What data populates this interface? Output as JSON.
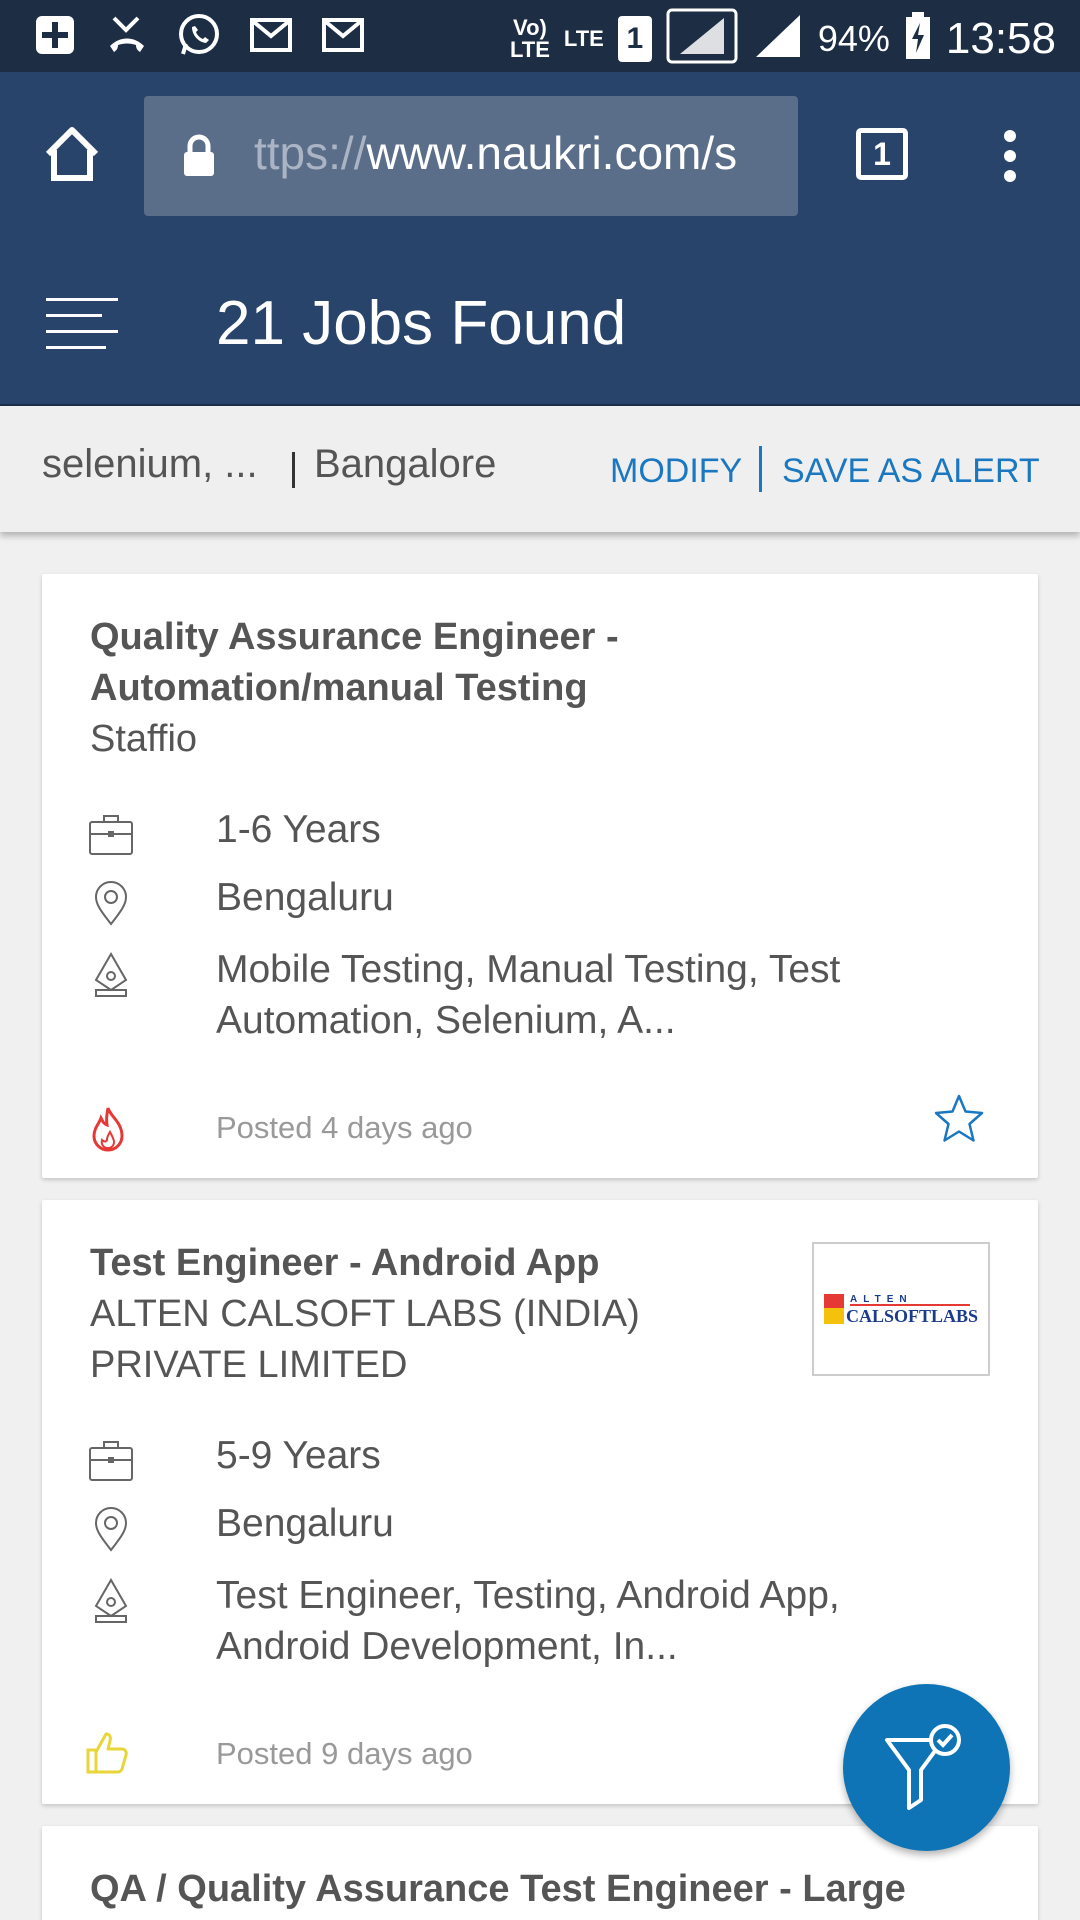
{
  "status_bar": {
    "network": "Vo) LTE",
    "lte": "LTE",
    "sim": "1",
    "battery": "94%",
    "time": "13:58"
  },
  "browser": {
    "url_prefix": "ttps://",
    "url_rest": "www.naukri.com/s",
    "tab_count": "1"
  },
  "header": {
    "title": "21 Jobs Found"
  },
  "search": {
    "keyword": "selenium, ...",
    "location": "Bangalore",
    "modify_label": "MODIFY",
    "alert_label": "SAVE AS ALERT"
  },
  "jobs": [
    {
      "title_line1": "Quality Assurance Engineer -",
      "title_line2": "Automation/manual Testing",
      "company": "Staffio",
      "experience": "1-6 Years",
      "location": "Bengaluru",
      "skills_line1": "Mobile Testing, Manual Testing, Test",
      "skills_line2": "Automation, Selenium, A...",
      "posted": "Posted 4 days ago"
    },
    {
      "title_line1": "Test Engineer - Android App",
      "company_line1": "ALTEN CALSOFT LABS (INDIA)",
      "company_line2": "PRIVATE LIMITED",
      "logo_top": "ALTEN",
      "logo_bottom": "CALSOFTLABS",
      "experience": "5-9 Years",
      "location": "Bengaluru",
      "skills_line1": "Test Engineer, Testing, Android App,",
      "skills_line2": "Android Development, In...",
      "posted": "Posted 9 days ago"
    },
    {
      "title_line1": "QA / Quality Assurance Test Engineer - Large"
    }
  ],
  "colors": {
    "header_bg": "#29446a",
    "status_bg": "#1c2d44",
    "accent": "#1b78c0",
    "fab": "#0e74b5",
    "hot": "#e53935",
    "thumbs": "#e8d53a"
  }
}
